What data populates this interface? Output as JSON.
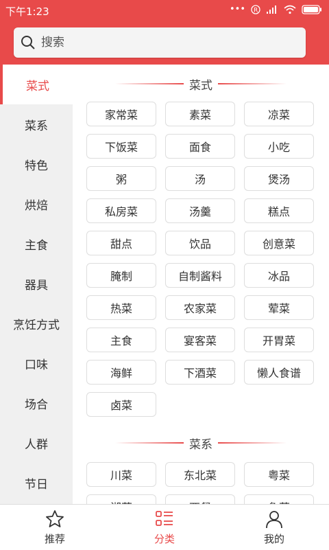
{
  "status": {
    "time": "下午1:23"
  },
  "search": {
    "placeholder": "搜索"
  },
  "colors": {
    "accent": "#e84a4a"
  },
  "sidebar": {
    "items": [
      {
        "label": "菜式",
        "active": true
      },
      {
        "label": "菜系"
      },
      {
        "label": "特色"
      },
      {
        "label": "烘焙"
      },
      {
        "label": "主食"
      },
      {
        "label": "器具"
      },
      {
        "label": "烹饪方式"
      },
      {
        "label": "口味"
      },
      {
        "label": "场合"
      },
      {
        "label": "人群"
      },
      {
        "label": "节日"
      }
    ]
  },
  "sections": [
    {
      "title": "菜式",
      "items": [
        "家常菜",
        "素菜",
        "凉菜",
        "下饭菜",
        "面食",
        "小吃",
        "粥",
        "汤",
        "煲汤",
        "私房菜",
        "汤羹",
        "糕点",
        "甜点",
        "饮品",
        "创意菜",
        "腌制",
        "自制酱料",
        "冰品",
        "热菜",
        "农家菜",
        "荤菜",
        "主食",
        "宴客菜",
        "开胃菜",
        "海鲜",
        "下酒菜",
        "懒人食谱",
        "卤菜"
      ]
    },
    {
      "title": "菜系",
      "items": [
        "川菜",
        "东北菜",
        "粤菜",
        "湘菜",
        "西餐",
        "鲁菜"
      ]
    }
  ],
  "bottom_nav": [
    {
      "label": "推荐",
      "icon": "star-icon"
    },
    {
      "label": "分类",
      "icon": "category-list-icon",
      "active": true
    },
    {
      "label": "我的",
      "icon": "user-icon"
    }
  ]
}
